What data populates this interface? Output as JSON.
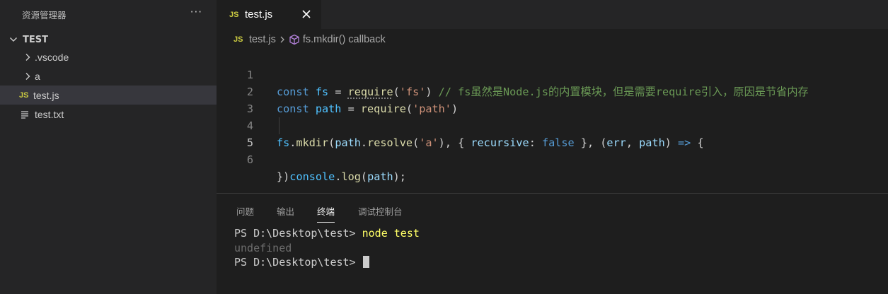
{
  "sidebar": {
    "title": "资源管理器",
    "more_label": "···",
    "folder_name": "TEST",
    "items": [
      {
        "label": ".vscode",
        "type": "folder"
      },
      {
        "label": "a",
        "type": "folder"
      },
      {
        "label": "test.js",
        "type": "js",
        "icon_text": "JS"
      },
      {
        "label": "test.txt",
        "type": "text"
      }
    ]
  },
  "tab": {
    "label": "test.js",
    "icon_text": "JS"
  },
  "breadcrumb": {
    "file": "test.js",
    "symbol": "fs.mkdir() callback",
    "icon_text": "JS"
  },
  "editor": {
    "line_numbers": [
      "1",
      "2",
      "3",
      "4",
      "5",
      "6"
    ],
    "lines": {
      "l1": {
        "kw": "const",
        "var": "fs",
        "eq": " = ",
        "fn": "require",
        "open": "(",
        "str": "'fs'",
        "close": ")",
        "comment": "// fs虽然是Node.js的内置模块，但是需要require引入，原因是节省内存"
      },
      "l2": {
        "kw": "const",
        "var": "path",
        "eq": " = ",
        "fn": "require",
        "open": "(",
        "str": "'path'",
        "close": ")"
      },
      "l4": {
        "obj": "fs",
        "dot": ".",
        "fn": "mkdir",
        "open": "(",
        "obj2": "path",
        "dot2": ".",
        "fn2": "resolve",
        "open2": "(",
        "str": "'a'",
        "close2": "), { ",
        "prop": "recursive",
        "colon": ": ",
        "bool": "false",
        "close3": " }, (",
        "p1": "err",
        "comma": ", ",
        "p2": "path",
        "arrow_pre": ") ",
        "arrow": "=>",
        "brace": " {"
      },
      "l5": {
        "obj": "console",
        "dot": ".",
        "fn": "log",
        "open": "(",
        "arg": "path",
        "close": ");"
      },
      "l6": {
        "text": "})"
      }
    }
  },
  "panel": {
    "tabs": [
      "问题",
      "输出",
      "终端",
      "调试控制台"
    ],
    "active_tab": "终端",
    "terminal": {
      "prompt1": "PS D:\\Desktop\\test> ",
      "command": "node test",
      "output": "undefined",
      "prompt2": "PS D:\\Desktop\\test> "
    }
  },
  "colors": {
    "keyword": "#569cd6",
    "variable": "#4fc1ff",
    "function": "#dcdcaa",
    "string": "#ce9178",
    "comment": "#6a9955",
    "js_icon": "#cbcb41"
  }
}
